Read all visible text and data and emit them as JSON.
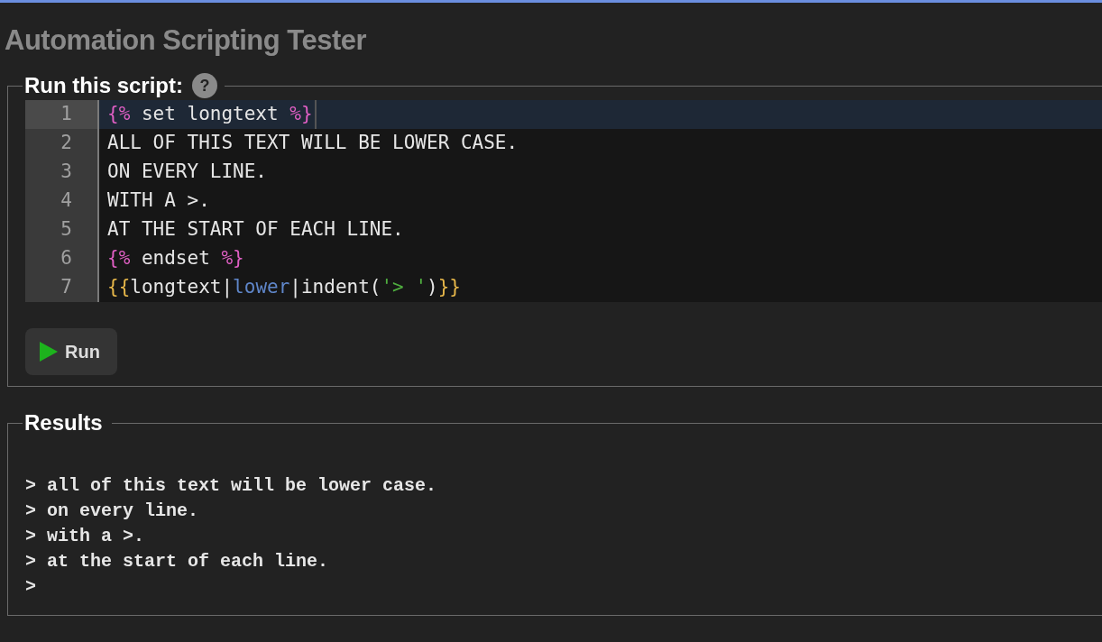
{
  "page": {
    "title": "Automation Scripting Tester"
  },
  "script_panel": {
    "legend": "Run this script:",
    "help_icon": "?",
    "editor": {
      "lines": [
        {
          "number": "1",
          "current": true,
          "tokens": [
            {
              "kind": "tag",
              "text": "{%"
            },
            {
              "kind": "plain",
              "text": " set longtext "
            },
            {
              "kind": "tag",
              "text": "%}"
            }
          ]
        },
        {
          "number": "2",
          "current": false,
          "tokens": [
            {
              "kind": "plain",
              "text": "ALL OF THIS TEXT WILL BE LOWER CASE."
            }
          ]
        },
        {
          "number": "3",
          "current": false,
          "tokens": [
            {
              "kind": "plain",
              "text": "ON EVERY LINE."
            }
          ]
        },
        {
          "number": "4",
          "current": false,
          "tokens": [
            {
              "kind": "plain",
              "text": "WITH A >."
            }
          ]
        },
        {
          "number": "5",
          "current": false,
          "tokens": [
            {
              "kind": "plain",
              "text": "AT THE START OF EACH LINE."
            }
          ]
        },
        {
          "number": "6",
          "current": false,
          "tokens": [
            {
              "kind": "tag",
              "text": "{%"
            },
            {
              "kind": "plain",
              "text": " endset "
            },
            {
              "kind": "tag",
              "text": "%}"
            }
          ]
        },
        {
          "number": "7",
          "current": false,
          "tokens": [
            {
              "kind": "brace",
              "text": "{{"
            },
            {
              "kind": "plain",
              "text": "longtext|"
            },
            {
              "kind": "filter",
              "text": "lower"
            },
            {
              "kind": "plain",
              "text": "|indent("
            },
            {
              "kind": "string",
              "text": "'> '"
            },
            {
              "kind": "plain",
              "text": ")"
            },
            {
              "kind": "brace",
              "text": "}}"
            }
          ]
        }
      ]
    },
    "run_button": "Run"
  },
  "results_panel": {
    "legend": "Results",
    "lines": [
      "> all of this text will be lower case.",
      "> on every line.",
      "> with a >.",
      "> at the start of each line.",
      ">"
    ]
  }
}
